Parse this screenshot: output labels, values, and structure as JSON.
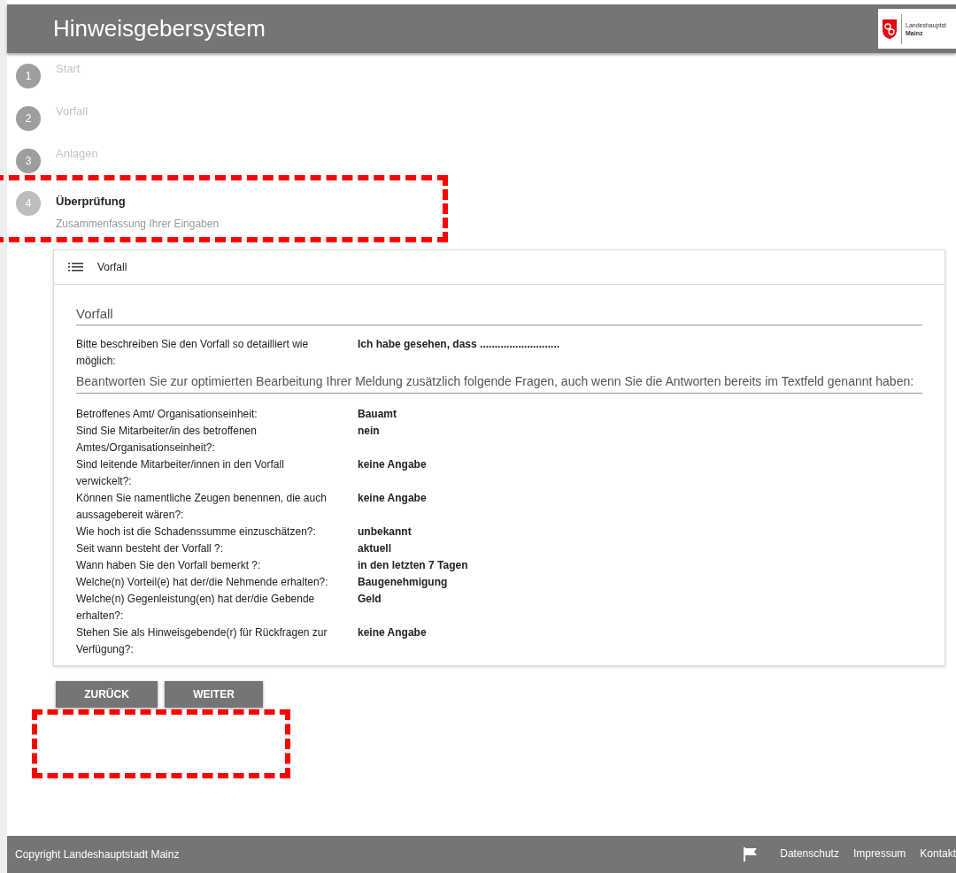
{
  "header": {
    "title": "Hinweisgebersystem",
    "logo_lines": [
      "Landeshauptst",
      "Mainz"
    ]
  },
  "steps": [
    {
      "number": "1",
      "label": "Start",
      "selected": false
    },
    {
      "number": "2",
      "label": "Vorfall",
      "selected": false
    },
    {
      "number": "3",
      "label": "Anlagen",
      "selected": false
    },
    {
      "number": "4",
      "label": "Überprüfung",
      "selected": true,
      "subtitle": "Zusammenfassung Ihrer Eingaben"
    }
  ],
  "card": {
    "title": "Vorfall",
    "section_title": "Vorfall",
    "description": {
      "label": "Bitte beschreiben Sie den Vorfall so detailliert wie möglich:",
      "value": "Ich habe gesehen, dass ..........................."
    },
    "notice": "Beantworten Sie zur optimierten Bearbeitung Ihrer Meldung zusätzlich folgende Fragen, auch wenn Sie die Antworten bereits im Textfeld genannt haben:",
    "answers": [
      {
        "label": "Betroffenes Amt/ Organisationseinheit:",
        "value": "Bauamt"
      },
      {
        "label": "Sind Sie Mitarbeiter/in des betroffenen Amtes/Organisationseinheit?:",
        "value": "nein"
      },
      {
        "label": "Sind leitende Mitarbeiter/innen in den Vorfall verwickelt?:",
        "value": "keine Angabe"
      },
      {
        "label": "Können Sie namentliche Zeugen benennen, die auch aussagebereit wären?:",
        "value": "keine Angabe"
      },
      {
        "label": "Wie hoch ist die Schadenssumme einzuschätzen?:",
        "value": "unbekannt"
      },
      {
        "label": "Seit wann besteht der Vorfall ?:",
        "value": "aktuell"
      },
      {
        "label": "Wann haben Sie den Vorfall bemerkt ?:",
        "value": "in den letzten 7 Tagen"
      },
      {
        "label": "Welche(n) Vorteil(e) hat der/die Nehmende erhalten?:",
        "value": "Baugenehmigung"
      },
      {
        "label": "Welche(n) Gegenleistung(en) hat der/die Gebende erhalten?:",
        "value": "Geld"
      },
      {
        "label": "Stehen Sie als Hinweisgebende(r) für Rückfragen zur Verfügung?:",
        "value": "keine Angabe"
      }
    ]
  },
  "buttons": [
    "ZURÜCK",
    "WEITER"
  ],
  "footer": {
    "copyright": "Copyright Landeshauptstadt Mainz",
    "links": [
      "Datenschutz",
      "Impressum",
      "Kontakt"
    ]
  }
}
